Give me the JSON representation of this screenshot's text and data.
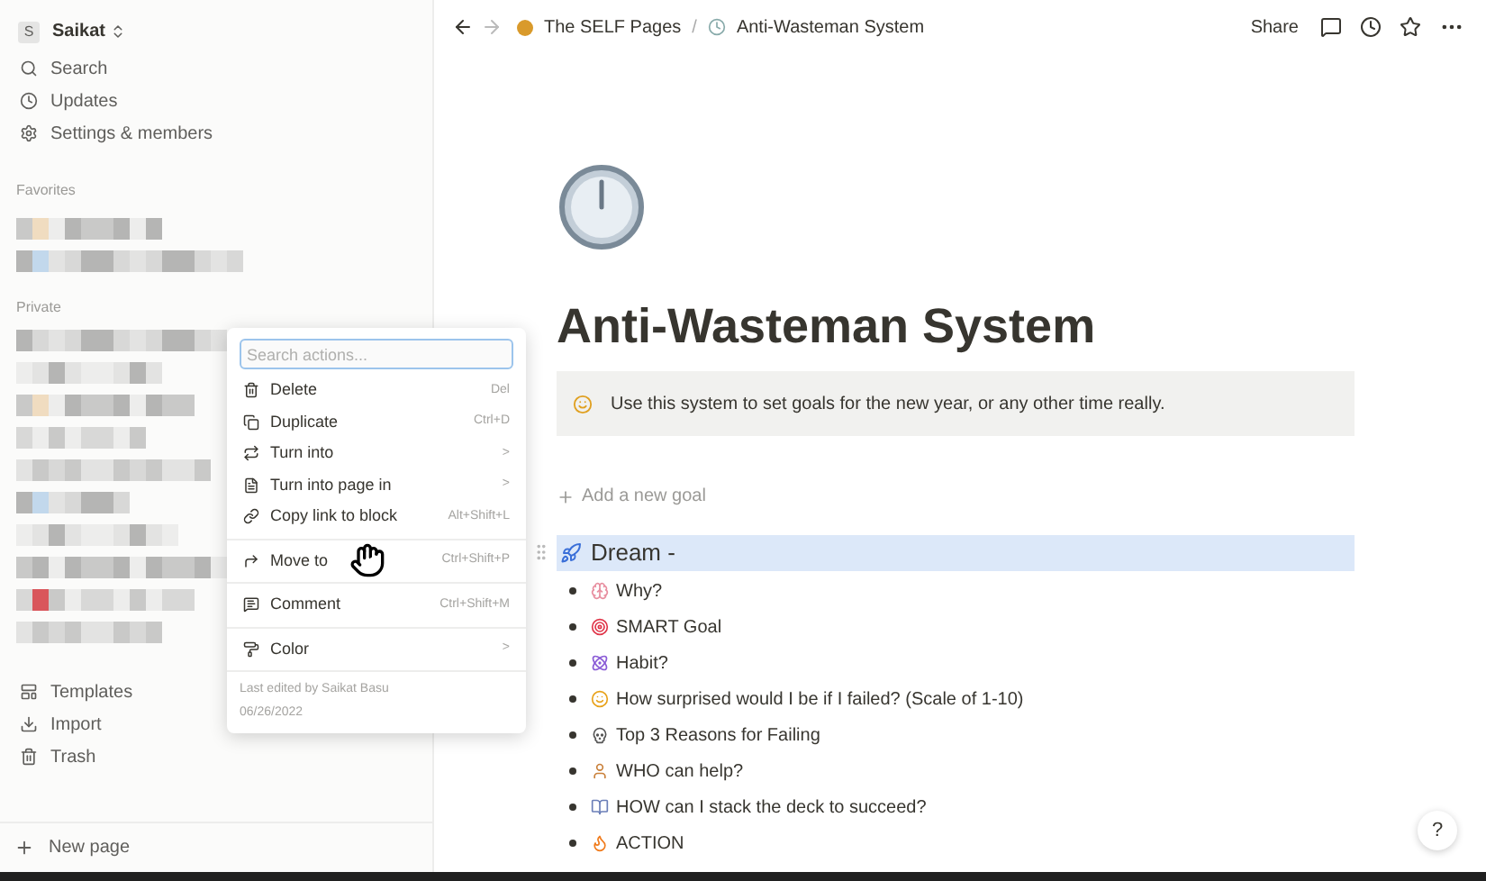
{
  "workspace": {
    "initial": "S",
    "name": "Saikat"
  },
  "sidebar": {
    "nav": [
      {
        "kind": "search",
        "label": "Search"
      },
      {
        "kind": "updates",
        "label": "Updates"
      },
      {
        "kind": "settings",
        "label": "Settings & members"
      }
    ],
    "favorites_heading": "Favorites",
    "private_heading": "Private",
    "bottom": [
      {
        "kind": "templates",
        "label": "Templates"
      },
      {
        "kind": "import",
        "label": "Import"
      },
      {
        "kind": "trash",
        "label": "Trash"
      }
    ],
    "new_page": "New page"
  },
  "breadcrumb": [
    "The SELF Pages",
    "/",
    "Anti-Wasteman System"
  ],
  "topbar_actions": {
    "share": "Share"
  },
  "page": {
    "title": "Anti-Wasteman System",
    "callout": "Use this system to set goals for the new year, or any other time really.",
    "add_goal": "Add a new goal",
    "heading": "Dream -",
    "heading_selected": true,
    "items": [
      {
        "kind": "brain",
        "text": "Why?"
      },
      {
        "kind": "target",
        "text": "SMART Goal"
      },
      {
        "kind": "atom",
        "text": "Habit?"
      },
      {
        "kind": "face",
        "text": "How surprised would I be if I failed? (Scale of 1-10)"
      },
      {
        "kind": "skull",
        "text": "Top 3 Reasons for Failing"
      },
      {
        "kind": "person",
        "text": "WHO can help?"
      },
      {
        "kind": "books",
        "text": "HOW can I stack the deck to succeed?"
      },
      {
        "kind": "fire",
        "text": "ACTION"
      }
    ]
  },
  "menu": {
    "search_placeholder": "Search actions...",
    "groups": [
      [
        {
          "kind": "delete",
          "label": "Delete",
          "shortcut": "Del"
        },
        {
          "kind": "duplicate",
          "label": "Duplicate",
          "shortcut": "Ctrl+D"
        },
        {
          "kind": "turn",
          "label": "Turn into",
          "shortcut": ">"
        },
        {
          "kind": "page",
          "label": "Turn into page in",
          "shortcut": ">"
        },
        {
          "kind": "link",
          "label": "Copy link to block",
          "shortcut": "Alt+Shift+L"
        }
      ],
      [
        {
          "kind": "move",
          "label": "Move to",
          "shortcut": "Ctrl+Shift+P"
        }
      ],
      [
        {
          "kind": "comment",
          "label": "Comment",
          "shortcut": "Ctrl+Shift+M"
        }
      ],
      [
        {
          "kind": "color",
          "label": "Color",
          "shortcut": ">"
        }
      ]
    ],
    "footer": [
      "Last edited by Saikat Basu",
      "06/26/2022"
    ]
  },
  "help": "?"
}
